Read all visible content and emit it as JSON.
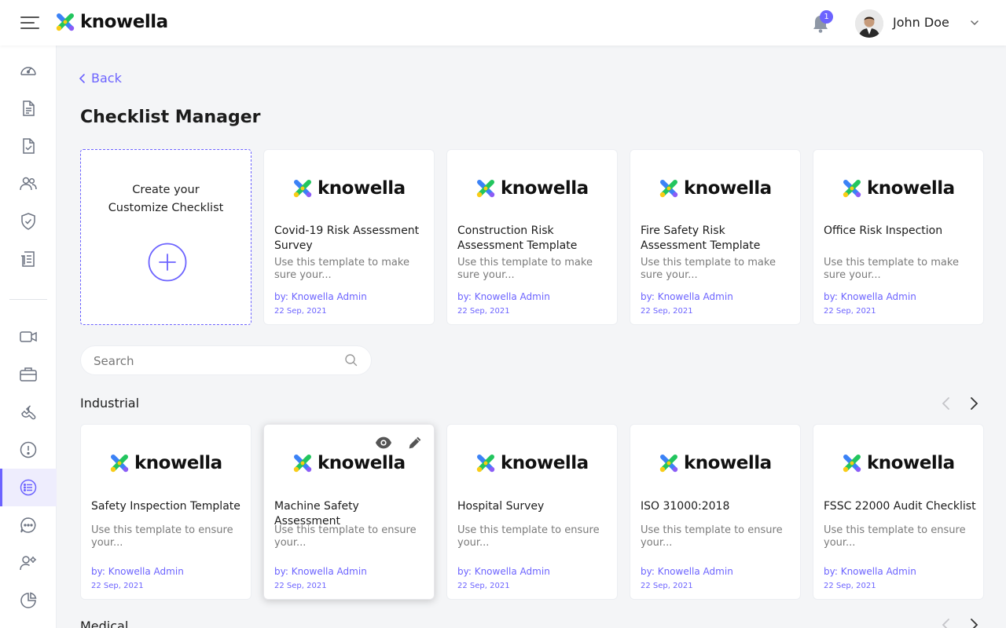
{
  "app": {
    "brand": "knowella"
  },
  "header": {
    "notifications_count": "1",
    "user_name": "John Doe"
  },
  "sidebar": {
    "items": [
      {
        "icon": "dashboard-icon"
      },
      {
        "icon": "document-icon"
      },
      {
        "icon": "checked-document-icon"
      },
      {
        "icon": "users-icon"
      },
      {
        "icon": "shield-icon"
      },
      {
        "icon": "report-icon"
      },
      {
        "icon": "video-icon"
      },
      {
        "icon": "briefcase-icon"
      },
      {
        "icon": "wrench-icon"
      },
      {
        "icon": "alert-icon"
      },
      {
        "icon": "checklist-icon",
        "active": true
      },
      {
        "icon": "chat-icon"
      },
      {
        "icon": "user-settings-icon"
      },
      {
        "icon": "pie-chart-icon"
      }
    ]
  },
  "main": {
    "back_label": "Back",
    "title": "Checklist Manager",
    "create_card": {
      "line1": "Create your",
      "line2": "Customize Checklist"
    },
    "featured": [
      {
        "title": "Covid-19 Risk Assessment Survey",
        "desc": "Use this template to make sure your...",
        "author": "by: Knowella Admin",
        "date": "22 Sep, 2021"
      },
      {
        "title": "Construction Risk Assessment Template",
        "desc": "Use this template to make sure your...",
        "author": "by: Knowella Admin",
        "date": "22 Sep, 2021"
      },
      {
        "title": "Fire Safety Risk Assessment Template",
        "desc": "Use this template to make sure your...",
        "author": "by: Knowella Admin",
        "date": "22 Sep, 2021"
      },
      {
        "title": "Office Risk Inspection",
        "desc": "Use this template to make sure your...",
        "author": "by: Knowella Admin",
        "date": "22 Sep, 2021"
      }
    ],
    "search": {
      "placeholder": "Search"
    },
    "sections": [
      {
        "title": "Industrial",
        "cards": [
          {
            "title": "Safety Inspection Template",
            "desc": "Use this template to ensure your...",
            "author": "by: Knowella Admin",
            "date": "22 Sep, 2021"
          },
          {
            "title": "Machine Safety Assessment",
            "desc": "Use this template to ensure your...",
            "author": "by: Knowella Admin",
            "date": "22 Sep, 2021"
          },
          {
            "title": "Hospital Survey",
            "desc": "Use this template to ensure your...",
            "author": "by: Knowella Admin",
            "date": "22 Sep, 2021"
          },
          {
            "title": "ISO 31000:2018",
            "desc": "Use this template to ensure your...",
            "author": "by: Knowella Admin",
            "date": "22 Sep, 2021"
          },
          {
            "title": "FSSC 22000 Audit Checklist",
            "desc": "Use this template to ensure your...",
            "author": "by: Knowella Admin",
            "date": "22 Sep, 2021"
          }
        ]
      },
      {
        "title": "Medical"
      }
    ]
  },
  "colors": {
    "accent": "#6c63ff",
    "logo_blue": "#3b82f6",
    "logo_green": "#22c55e",
    "logo_yellow": "#facc15",
    "logo_purple": "#8b5cf6"
  }
}
